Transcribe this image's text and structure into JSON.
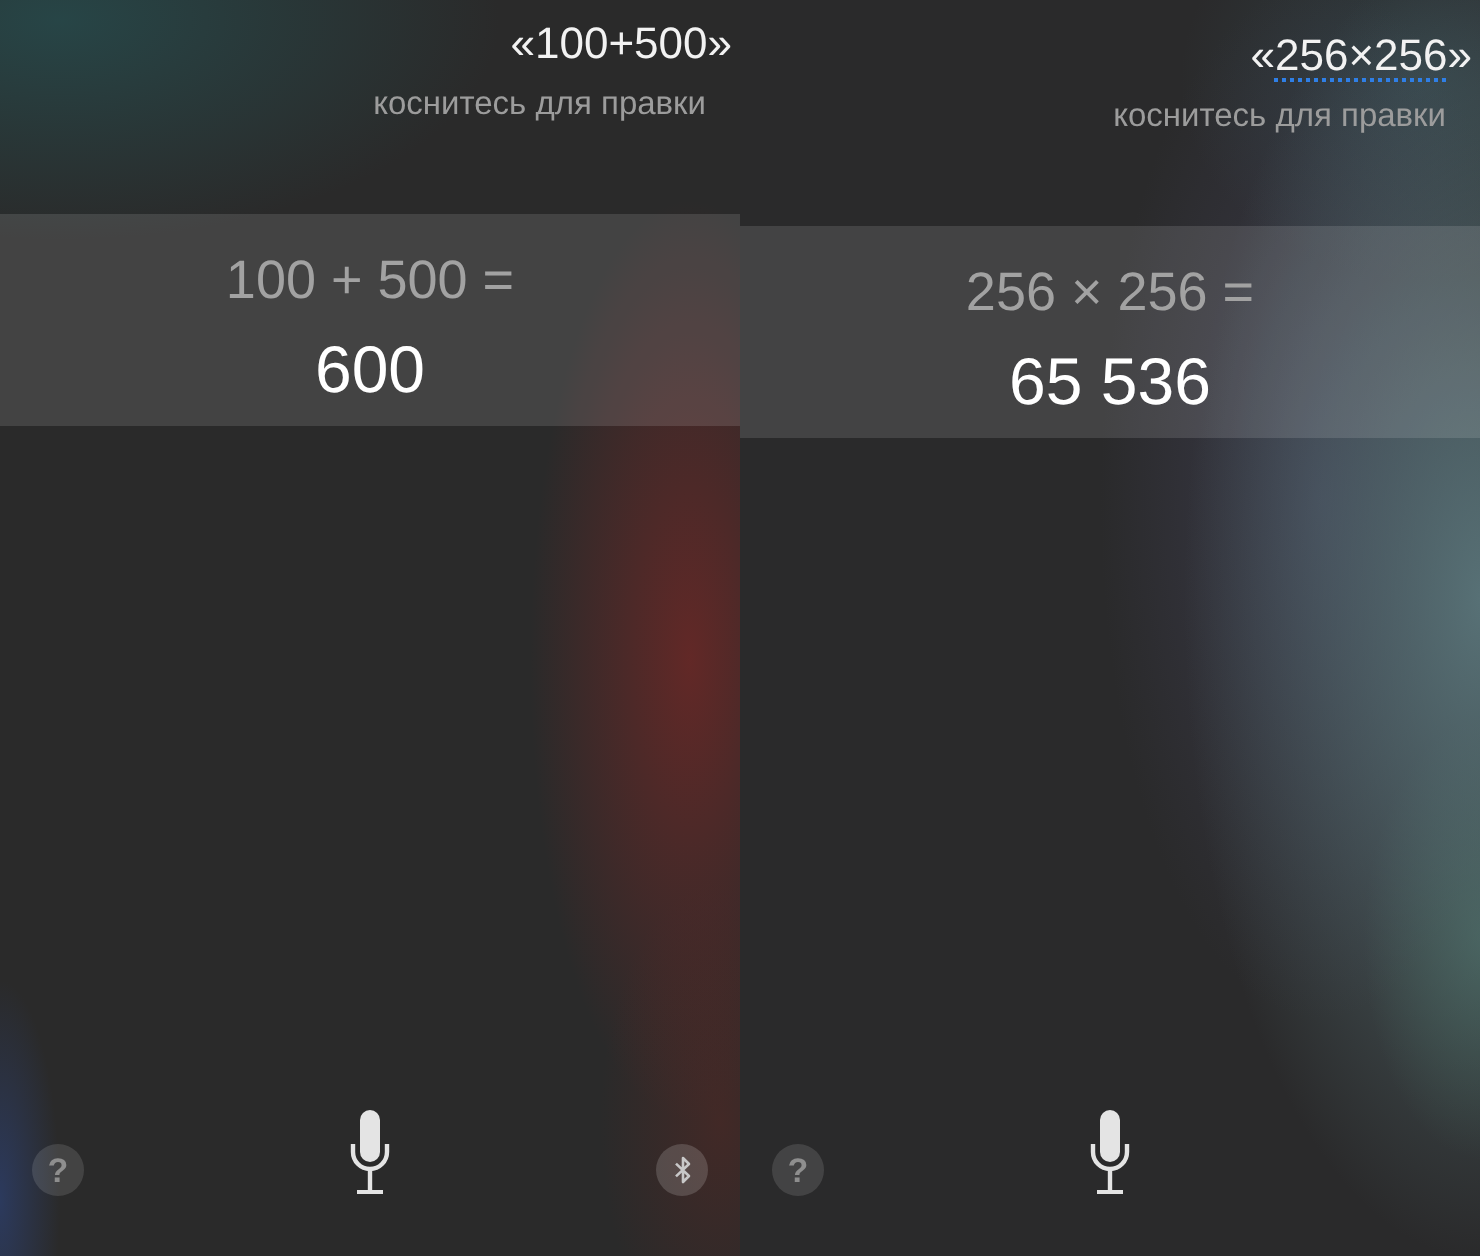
{
  "panels": [
    {
      "query": {
        "before": "«",
        "text": "100+500",
        "after": "»",
        "underlined": false
      },
      "hint": "коснитесь для правки",
      "expression": "100 + 500 =",
      "result": "600",
      "buttons": [
        {
          "kind": "help",
          "label": "?"
        },
        {
          "kind": "mic"
        },
        {
          "kind": "bluetooth"
        }
      ]
    },
    {
      "query": {
        "before": "«",
        "text": "256×256",
        "after": "»",
        "underlined": true
      },
      "hint": "коснитесь для правки",
      "expression": "256 × 256 =",
      "result": "65 536",
      "buttons": [
        {
          "kind": "help",
          "label": "?"
        },
        {
          "kind": "mic"
        }
      ]
    }
  ]
}
